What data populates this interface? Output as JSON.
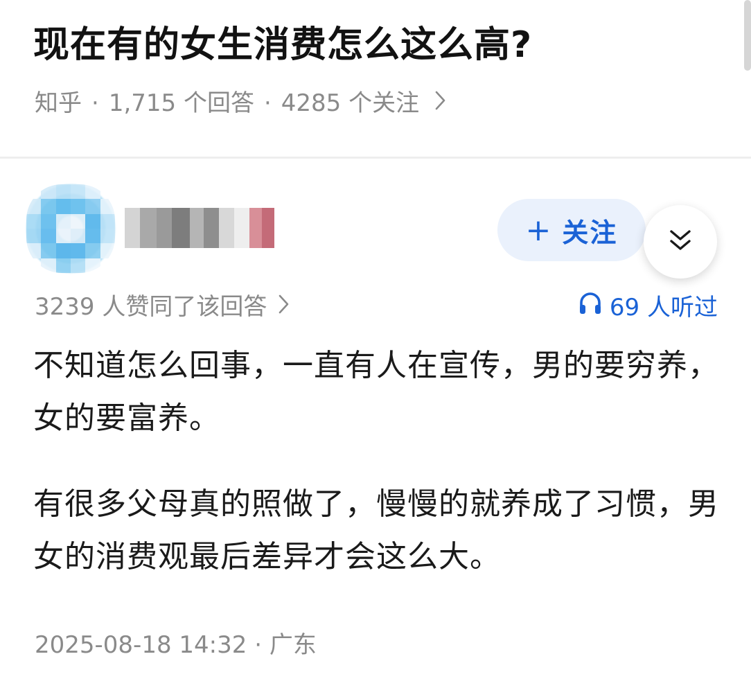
{
  "question": {
    "title": "现在有的女生消费怎么这么高?",
    "source": "知乎",
    "answer_count": "1,715 个回答",
    "follower_count": "4285 个关注",
    "separator": "·"
  },
  "author": {
    "follow_label": "关注",
    "follow_plus": "+"
  },
  "answer": {
    "votes_text": "3239 人赞同了该回答",
    "listen_text": "69 人听过",
    "paragraphs": [
      "不知道怎么回事，一直有人在宣传，男的要穷养，女的要富养。",
      "有很多父母真的照做了，慢慢的就养成了习惯，男女的消费观最后差异才会这么大。"
    ],
    "timestamp": "2025-08-18 14:32",
    "location": "广东"
  },
  "colors": {
    "accent": "#1a62d6",
    "follow_bg": "#eaf1fc",
    "meta_gray": "#8a8a8a"
  },
  "icons": {
    "chevron": "chevron-right-icon",
    "collapse": "double-chevron-down-icon",
    "headphones": "headphones-icon"
  }
}
